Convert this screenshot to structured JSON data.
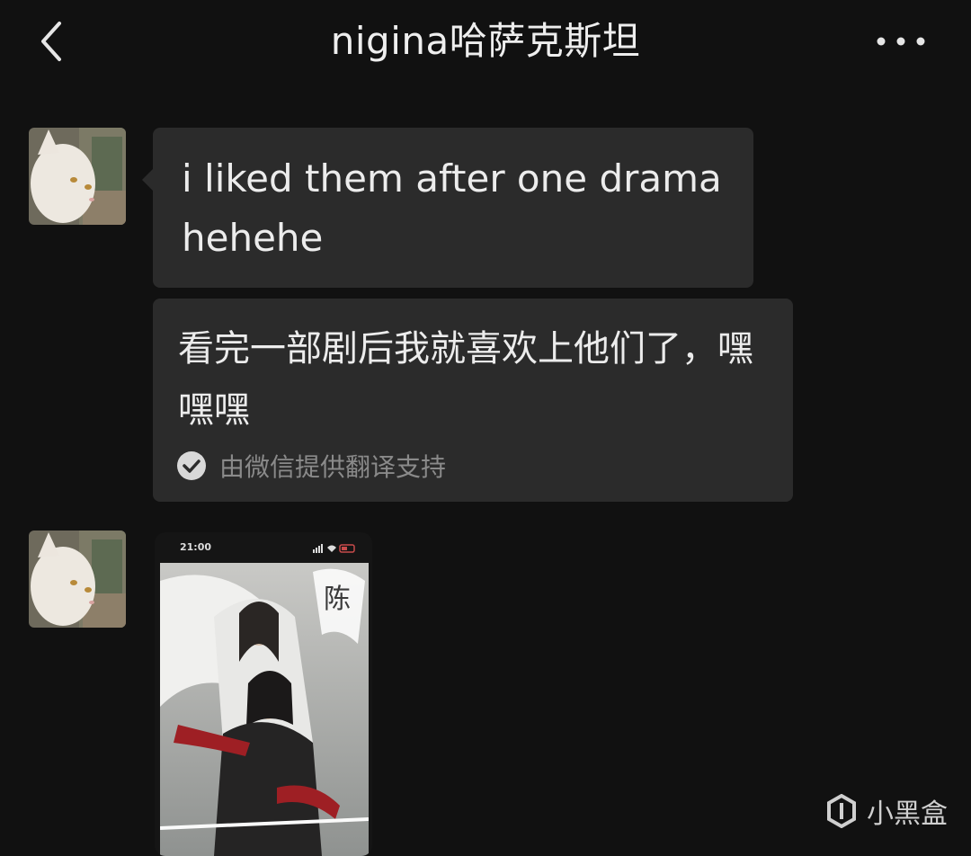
{
  "header": {
    "title": "nigina哈萨克斯坦"
  },
  "messages": [
    {
      "text": "i liked them after one drama hehehe"
    },
    {
      "translation": "看完一部剧后我就喜欢上他们了，嘿嘿嘿",
      "translation_note": "由微信提供翻译支持"
    }
  ],
  "image_message": {
    "status_time": "21:00"
  },
  "watermark": {
    "text": "小黑盒"
  },
  "icons": [
    "back-arrow-icon",
    "more-options-icon",
    "checkmark-icon",
    "watermark-logo-icon"
  ],
  "colors": {
    "background": "#111111",
    "bubble": "#2b2b2b",
    "text": "#ececec",
    "muted": "#8a8a8a"
  }
}
